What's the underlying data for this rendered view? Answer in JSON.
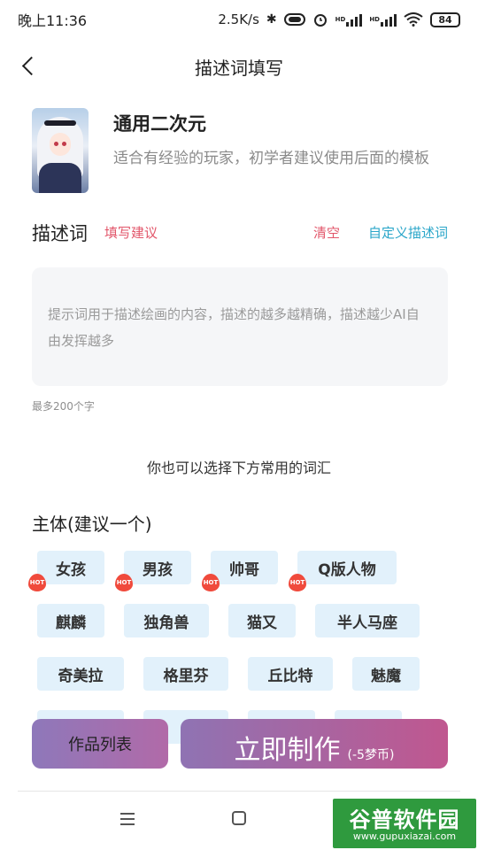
{
  "status_bar": {
    "time": "晚上11:36",
    "speed": "2.5K/s",
    "icons": [
      "bluetooth-icon",
      "toggle-icon",
      "alarm-icon",
      "hd-signal-icon",
      "hd-signal-icon",
      "wifi-icon"
    ],
    "hd1": "HD",
    "hd2": "HD",
    "battery": "84"
  },
  "header": {
    "title": "描述词填写"
  },
  "style_card": {
    "name": "通用二次元",
    "desc": "适合有经验的玩家，初学者建议使用后面的模板"
  },
  "description": {
    "title": "描述词",
    "tips": "填写建议",
    "clear": "清空",
    "custom": "自定义描述词",
    "placeholder": "提示词用于描述绘画的内容，描述的越多越精确，描述越少AI自由发挥越多",
    "limit": "最多200个字"
  },
  "hint": "你也可以选择下方常用的词汇",
  "subject": {
    "title": "主体(建议一个)",
    "hot_label": "HOT",
    "tags": [
      {
        "label": "女孩",
        "hot": true
      },
      {
        "label": "男孩",
        "hot": true
      },
      {
        "label": "帅哥",
        "hot": true
      },
      {
        "label": "Q版人物",
        "hot": true
      },
      {
        "label": "麒麟",
        "hot": false
      },
      {
        "label": "独角兽",
        "hot": false
      },
      {
        "label": "猫又",
        "hot": false
      },
      {
        "label": "半人马座",
        "hot": false
      },
      {
        "label": "奇美拉",
        "hot": false
      },
      {
        "label": "格里芬",
        "hot": false
      },
      {
        "label": "丘比特",
        "hot": false
      },
      {
        "label": "魅魔",
        "hot": false
      }
    ]
  },
  "buttons": {
    "works": "作品列表",
    "make": "立即制作",
    "make_cost": "(-5梦币)"
  },
  "colors": {
    "accent_red": "#e2566a",
    "accent_blue": "#2aa6c9",
    "tag_bg": "#e2f1fb",
    "hot_badge": "#f04a3c"
  },
  "watermark": {
    "title": "谷普软件园",
    "url": "www.gupuxiazai.com"
  }
}
